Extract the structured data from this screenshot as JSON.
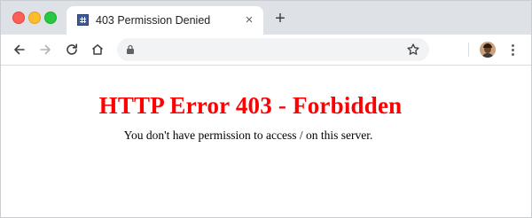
{
  "window": {
    "controls": [
      "close",
      "minimize",
      "maximize"
    ]
  },
  "tab": {
    "title": "403 Permission Denied",
    "favicon": "grid-icon",
    "close_glyph": "×"
  },
  "new_tab_glyph": "+",
  "toolbar": {
    "back_icon": "arrow-left-icon",
    "forward_icon": "arrow-right-icon",
    "reload_icon": "reload-icon",
    "home_icon": "home-icon",
    "lock_icon": "lock-icon",
    "url": "",
    "bookmark_icon": "star-icon",
    "avatar_icon": "avatar-icon",
    "menu_icon": "more-vert-icon"
  },
  "page": {
    "title": "HTTP Error 403 - Forbidden",
    "message": "You don't have permission to access / on this server."
  },
  "colors": {
    "title_red": "#ff0000",
    "tabstrip": "#dee1e6",
    "omnibox": "#f1f3f4"
  }
}
